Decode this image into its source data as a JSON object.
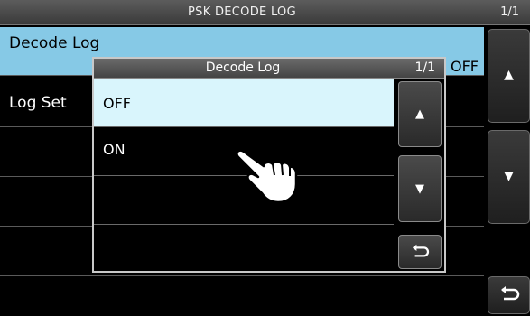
{
  "title_bar": {
    "title": "PSK DECODE LOG",
    "page": "1/1"
  },
  "background_list": {
    "rows": [
      {
        "label": "Decode Log",
        "value": "OFF",
        "selected": true
      },
      {
        "label": "Log Set",
        "value": ""
      },
      {
        "label": "",
        "value": ""
      },
      {
        "label": "",
        "value": ""
      },
      {
        "label": "",
        "value": ""
      }
    ]
  },
  "side_buttons": {
    "up": "▲",
    "down": "▼",
    "back": "⮌"
  },
  "dialog": {
    "title": "Decode Log",
    "page": "1/1",
    "options": [
      {
        "label": "OFF",
        "selected": true
      },
      {
        "label": "ON",
        "selected": false
      },
      {
        "label": "",
        "selected": false
      },
      {
        "label": "",
        "selected": false
      }
    ],
    "buttons": {
      "up": "▲",
      "down": "▼",
      "back": "⮌"
    }
  },
  "colors": {
    "selected_bg": "#86c9e6",
    "dialog_selected_bg": "#d9f5fc",
    "background": "#000000"
  },
  "cursor": {
    "icon": "hand-pointer-icon"
  }
}
